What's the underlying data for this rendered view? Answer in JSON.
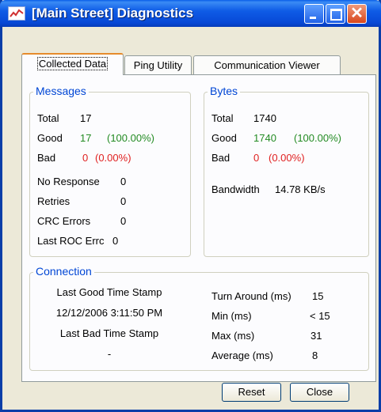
{
  "window": {
    "title": "[Main Street] Diagnostics"
  },
  "tabs": [
    {
      "label": "Collected Data"
    },
    {
      "label": "Ping Utility"
    },
    {
      "label": "Communication Viewer"
    }
  ],
  "messages": {
    "legend": "Messages",
    "total_label": "Total",
    "total_value": "17",
    "good_label": "Good",
    "good_value": "17",
    "good_pct": "(100.00%)",
    "bad_label": "Bad",
    "bad_value": "0",
    "bad_pct": "(0.00%)",
    "no_response_label": "No Response",
    "no_response_value": "0",
    "retries_label": "Retries",
    "retries_value": "0",
    "crc_label": "CRC Errors",
    "crc_value": "0",
    "last_roc_label": "Last ROC Errc",
    "last_roc_value": "0"
  },
  "bytes": {
    "legend": "Bytes",
    "total_label": "Total",
    "total_value": "1740",
    "good_label": "Good",
    "good_value": "1740",
    "good_pct": "(100.00%)",
    "bad_label": "Bad",
    "bad_value": "0",
    "bad_pct": "(0.00%)",
    "bandwidth_label": "Bandwidth",
    "bandwidth_value": "14.78 KB/s"
  },
  "connection": {
    "legend": "Connection",
    "last_good_label": "Last Good Time Stamp",
    "last_good_value": "12/12/2006 3:11:50 PM",
    "last_bad_label": "Last Bad Time Stamp",
    "last_bad_value": "-",
    "turn_around_label": "Turn Around (ms)",
    "turn_around_value": "15",
    "min_label": "Min (ms)",
    "min_value": "< 15",
    "max_label": "Max (ms)",
    "max_value": "31",
    "avg_label": "Average (ms)",
    "avg_value": "8"
  },
  "buttons": {
    "reset": "Reset",
    "close": "Close"
  },
  "colors": {
    "title_bar": "#0a5ee8",
    "legend_text": "#0046d5",
    "good": "#238b23",
    "bad": "#e02020"
  }
}
